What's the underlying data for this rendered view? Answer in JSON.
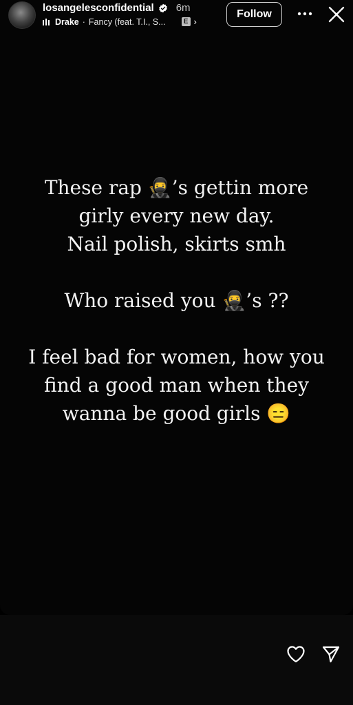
{
  "header": {
    "username": "losangelesconfidential",
    "time_ago": "6m",
    "music": {
      "artist": "Drake",
      "separator": "·",
      "track": "Fancy (feat. T.I., S...",
      "explicit_label": "E",
      "chevron": "›"
    },
    "follow_label": "Follow",
    "more_icon": "ellipsis-icon",
    "close_icon": "close-icon"
  },
  "story": {
    "lines": [
      "These rap 🥷’s gettin more",
      "girly every new day.",
      "Nail polish, skirts smh",
      "",
      "Who raised you 🥷’s ??",
      "",
      "I feel bad for women, how you",
      "find a good man when they",
      "wanna be good girls 😑"
    ]
  },
  "footer": {
    "like_icon": "heart-icon",
    "share_icon": "send-icon"
  },
  "colors": {
    "background": "#000000",
    "text": "#f2f2f2",
    "verified": "#ffffff"
  }
}
